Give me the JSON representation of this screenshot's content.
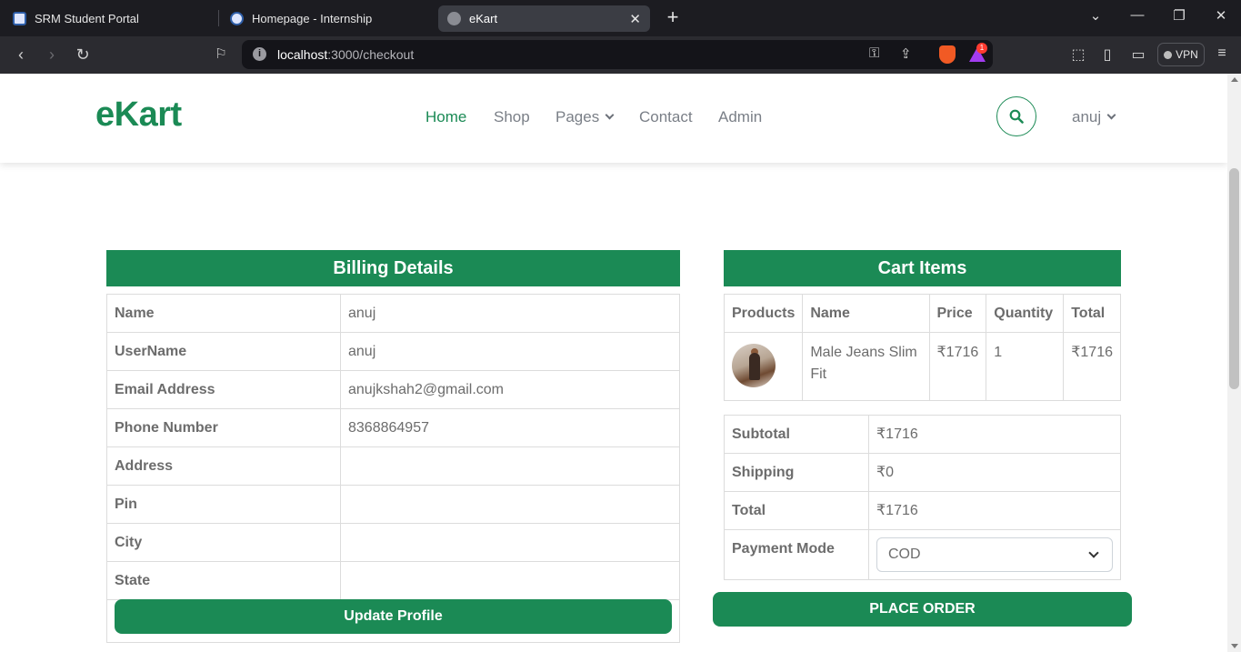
{
  "browser": {
    "tabs": [
      {
        "title": "SRM Student Portal"
      },
      {
        "title": "Homepage - Internship"
      },
      {
        "title": "eKart"
      }
    ],
    "address": {
      "host": "localhost",
      "rest": ":3000/checkout"
    },
    "vpn_label": "VPN",
    "rewards_count": "1"
  },
  "header": {
    "logo": "eKart",
    "nav": {
      "home": "Home",
      "shop": "Shop",
      "pages": "Pages",
      "contact": "Contact",
      "admin": "Admin"
    },
    "user": "anuj"
  },
  "billing": {
    "title": "Billing Details",
    "rows": [
      {
        "label": "Name",
        "value": "anuj"
      },
      {
        "label": "UserName",
        "value": "anuj"
      },
      {
        "label": "Email Address",
        "value": "anujkshah2@gmail.com"
      },
      {
        "label": "Phone Number",
        "value": "8368864957"
      },
      {
        "label": "Address",
        "value": ""
      },
      {
        "label": "Pin",
        "value": ""
      },
      {
        "label": "City",
        "value": ""
      },
      {
        "label": "State",
        "value": ""
      }
    ],
    "update_button": "Update Profile"
  },
  "cart": {
    "title": "Cart Items",
    "columns": {
      "products": "Products",
      "name": "Name",
      "price": "Price",
      "quantity": "Quantity",
      "total": "Total"
    },
    "items": [
      {
        "name": "Male Jeans Slim Fit",
        "price": "₹1716",
        "quantity": "1",
        "total": "₹1716"
      }
    ]
  },
  "summary": {
    "subtotal_label": "Subtotal",
    "subtotal": "₹1716",
    "shipping_label": "Shipping",
    "shipping": "₹0",
    "total_label": "Total",
    "total": "₹1716",
    "payment_label": "Payment Mode",
    "payment_selected": "COD"
  },
  "place_order": "PLACE ORDER",
  "colors": {
    "brand": "#1b8a55"
  }
}
